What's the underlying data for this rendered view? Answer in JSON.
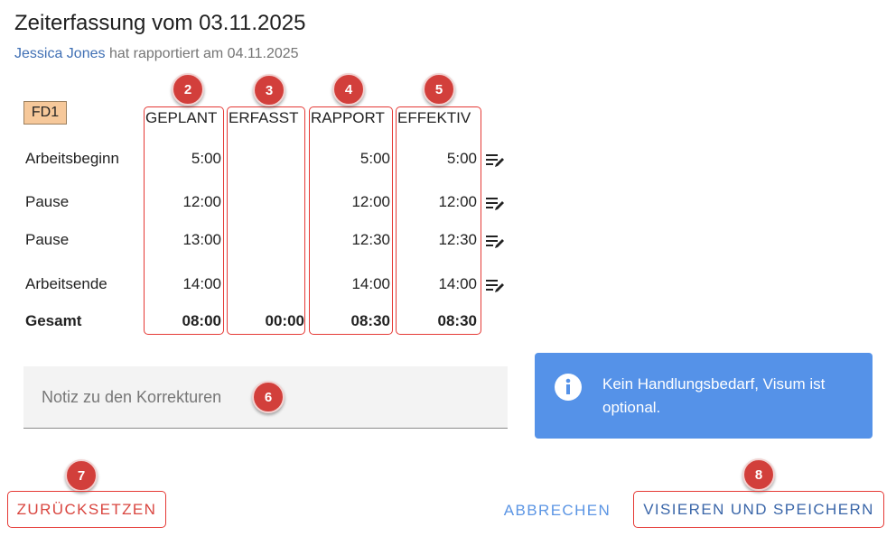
{
  "header": {
    "title": "Zeiterfassung vom 03.11.2025",
    "user": "Jessica Jones",
    "reported_text": "hat rapportiert am 04.11.2025"
  },
  "chip": "FD1",
  "columns": [
    {
      "label": "GEPLANT",
      "badge": "2"
    },
    {
      "label": "ERFASST",
      "badge": "3"
    },
    {
      "label": "RAPPORT",
      "badge": "4"
    },
    {
      "label": "EFFEKTIV",
      "badge": "5"
    }
  ],
  "rows": [
    {
      "label": "Arbeitsbeginn",
      "geplant": "5:00",
      "erfasst": "",
      "rapport": "5:00",
      "effektiv": "5:00"
    },
    {
      "label": "Pause",
      "geplant": "12:00",
      "erfasst": "",
      "rapport": "12:00",
      "effektiv": "12:00"
    },
    {
      "label": "Pause",
      "geplant": "13:00",
      "erfasst": "",
      "rapport": "12:30",
      "effektiv": "12:30"
    },
    {
      "label": "Arbeitsende",
      "geplant": "14:00",
      "erfasst": "",
      "rapport": "14:00",
      "effektiv": "14:00"
    }
  ],
  "total": {
    "label": "Gesamt",
    "geplant": "08:00",
    "erfasst": "00:00",
    "rapport": "08:30",
    "effektiv": "08:30"
  },
  "note": {
    "placeholder": "Notiz zu den Korrekturen",
    "badge": "6"
  },
  "info": {
    "text": "Kein Handlungsbedarf, Visum ist optional.",
    "icon": "info-icon"
  },
  "buttons": {
    "reset": "Zurücksetzen",
    "reset_badge": "7",
    "cancel": "Abbrechen",
    "save": "Visieren und Speichern",
    "save_badge": "8"
  },
  "colors": {
    "accent": "#5b95e4",
    "highlight": "#e53935",
    "badge": "#d23f3b",
    "info_bg": "#5592e8",
    "chip_bg": "#f6c89a"
  }
}
